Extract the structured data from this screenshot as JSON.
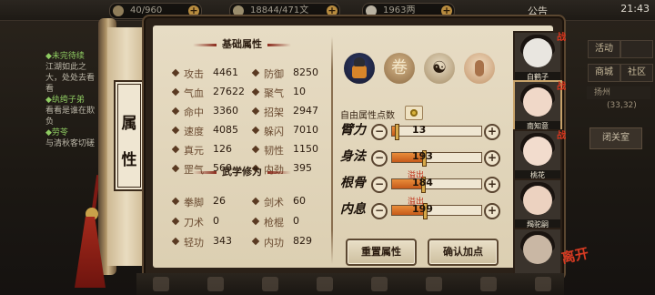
{
  "topbar": {
    "resource1": "40/960",
    "resource2": "18844/471文",
    "resource3": "1963两",
    "announce": "公告",
    "clock": "21:43"
  },
  "questlog": {
    "items": [
      {
        "title": "◆未完待续",
        "sub": "江湖如此之大，处处去看看"
      },
      {
        "title": "◆纨绔子弟",
        "sub": "看看是谁在欺负"
      },
      {
        "title": "◆劳苓",
        "sub": "与清秋客切磋"
      }
    ]
  },
  "right_menu": {
    "activity": "活动",
    "shop": "商城",
    "community": "社区",
    "location": "扬州",
    "coords": "(33,32)",
    "close_hall": "闭关室"
  },
  "scroll": {
    "label": "属性"
  },
  "basic": {
    "title": "基础属性",
    "stats": [
      {
        "label": "攻击",
        "value": "4461"
      },
      {
        "label": "防御",
        "value": "8250"
      },
      {
        "label": "气血",
        "value": "27622"
      },
      {
        "label": "聚气",
        "value": "10"
      },
      {
        "label": "命中",
        "value": "3360"
      },
      {
        "label": "招架",
        "value": "2947"
      },
      {
        "label": "速度",
        "value": "4085"
      },
      {
        "label": "躲闪",
        "value": "7010"
      },
      {
        "label": "真元",
        "value": "126"
      },
      {
        "label": "韧性",
        "value": "1150"
      },
      {
        "label": "罡气",
        "value": "560"
      },
      {
        "label": "内劲",
        "value": "395"
      }
    ]
  },
  "martial": {
    "title": "武学修为",
    "stats": [
      {
        "label": "拳脚",
        "value": "26"
      },
      {
        "label": "剑术",
        "value": "60"
      },
      {
        "label": "刀术",
        "value": "0"
      },
      {
        "label": "枪棍",
        "value": "0"
      },
      {
        "label": "轻功",
        "value": "343"
      },
      {
        "label": "内功",
        "value": "829"
      }
    ]
  },
  "stances": [
    {
      "name": "warrior-stance-icon"
    },
    {
      "name": "scroll-stance-icon",
      "glyph": "卷"
    },
    {
      "name": "taiji-stance-icon",
      "glyph": "☯"
    },
    {
      "name": "martial-pose-icon"
    }
  ],
  "free_points": {
    "label": "自由属性点数"
  },
  "allocation": {
    "overflow_label": "溢出",
    "rows": [
      {
        "label": "臂力",
        "value": "13",
        "fill": 0.03,
        "overflow": false
      },
      {
        "label": "身法",
        "value": "193",
        "fill": 0.35,
        "overflow": false
      },
      {
        "label": "根骨",
        "value": "184",
        "fill": 0.34,
        "overflow": true
      },
      {
        "label": "内息",
        "value": "199",
        "fill": 0.36,
        "overflow": true
      }
    ]
  },
  "buttons": {
    "reset": "重置属性",
    "confirm": "确认加点"
  },
  "roster": [
    {
      "name": "白鹤子",
      "tag": "战",
      "skin": "#e9e6e0",
      "selected": false
    },
    {
      "name": "南知意",
      "tag": "战",
      "skin": "#f0d8c8",
      "selected": true
    },
    {
      "name": "桃花",
      "tag": "战",
      "skin": "#f2dccd",
      "selected": false
    },
    {
      "name": "羯驼嗣",
      "tag": "",
      "skin": "#ecd2c0",
      "selected": false
    },
    {
      "name": "",
      "tag": "",
      "skin": "#c9b7a4",
      "selected": false
    }
  ],
  "leave_label": "离开",
  "colors": {
    "accent_red": "#c03018",
    "bar_fill": "#e98d3a",
    "paper": "#e7dcc4"
  }
}
